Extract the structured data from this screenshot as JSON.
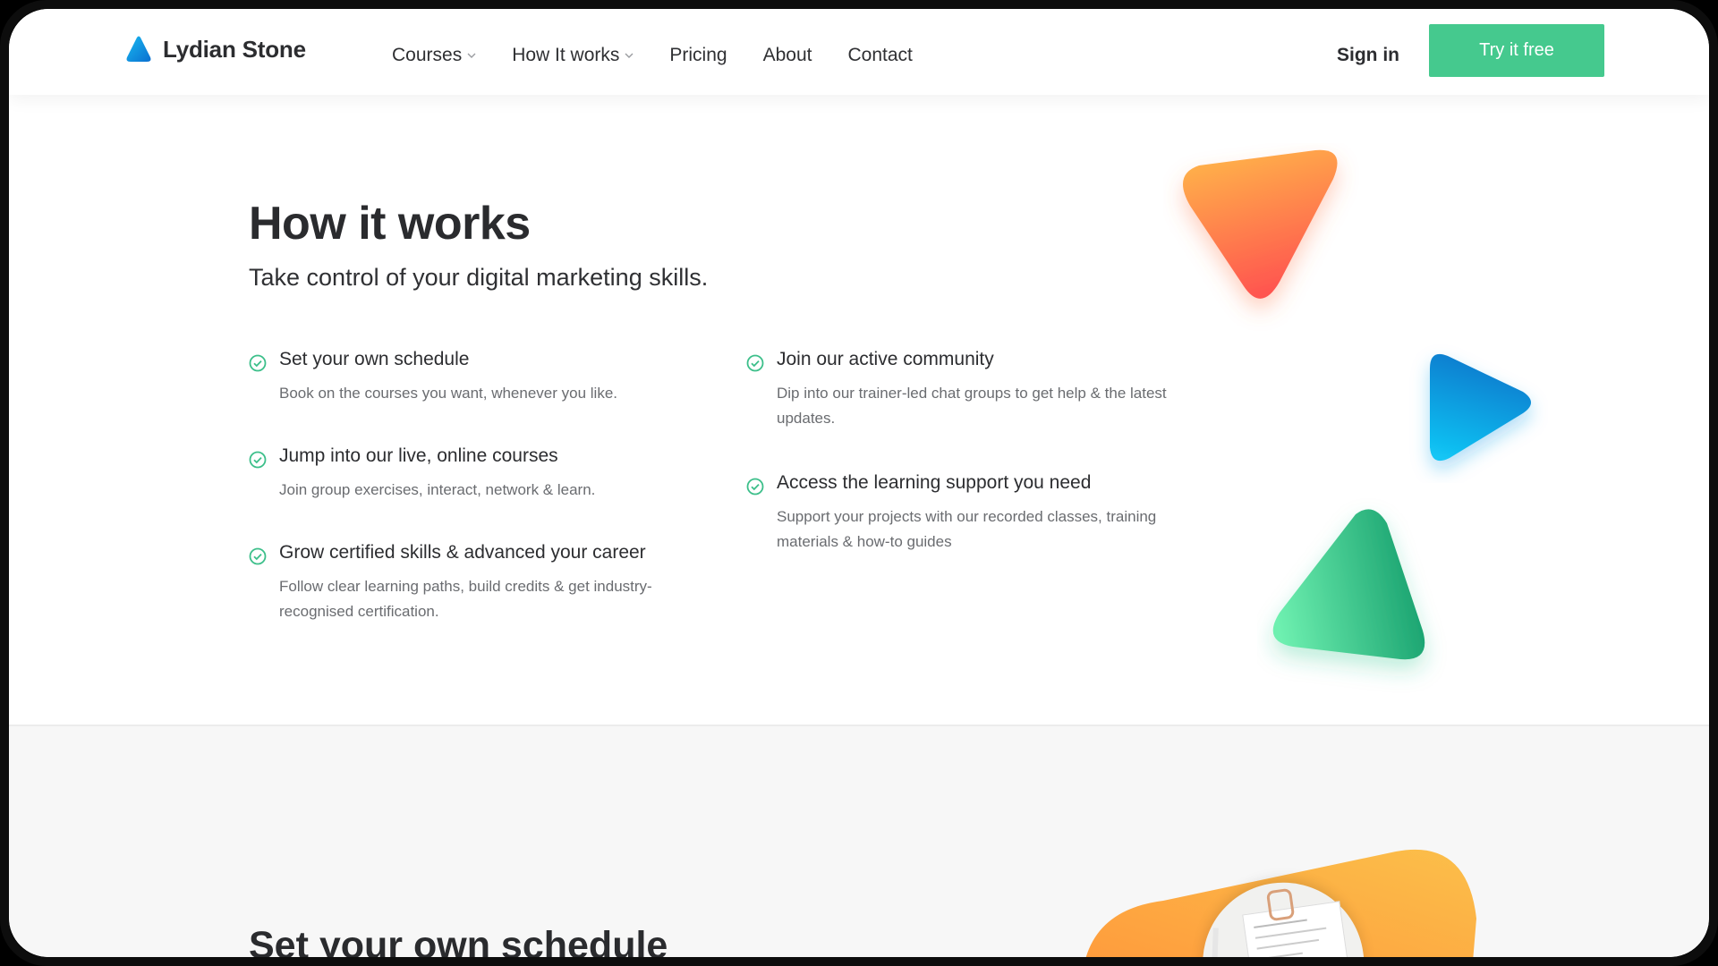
{
  "brand": {
    "name": "Lydian Stone"
  },
  "nav": {
    "items": [
      {
        "label": "Courses",
        "has_dropdown": true
      },
      {
        "label": "How It works",
        "has_dropdown": true
      },
      {
        "label": "Pricing",
        "has_dropdown": false
      },
      {
        "label": "About",
        "has_dropdown": false
      },
      {
        "label": "Contact",
        "has_dropdown": false
      }
    ],
    "sign_in": "Sign in",
    "cta": "Try it free"
  },
  "hero": {
    "title": "How it works",
    "subtitle": "Take control of your digital marketing skills."
  },
  "features": [
    {
      "title": "Set your own schedule",
      "desc": "Book on the courses you want, whenever you like."
    },
    {
      "title": "Jump into our live, online courses",
      "desc": "Join group exercises, interact, network & learn."
    },
    {
      "title": "Grow certified skills & advanced your career",
      "desc": "Follow clear learning paths, build credits & get industry-recognised certification."
    },
    {
      "title": "Join our active community",
      "desc": "Dip into our trainer-led chat groups to get help & the latest updates."
    },
    {
      "title": "Access the learning support you need",
      "desc": "Support your projects with our recorded classes, training materials & how-to guides"
    }
  ],
  "lower": {
    "title": "Set your own schedule"
  },
  "colors": {
    "accent": "#45c98e",
    "check": "#3cbf8a",
    "orange": "#ff9a45",
    "red": "#ff5a5a",
    "blue": "#0b84d6",
    "cyan": "#12c2f2",
    "green": "#1aa872",
    "mint": "#6ef0b0"
  },
  "icons": {
    "logo": "logo-triangle-icon",
    "dropdown": "chevron-down-icon",
    "check": "check-circle-icon"
  }
}
